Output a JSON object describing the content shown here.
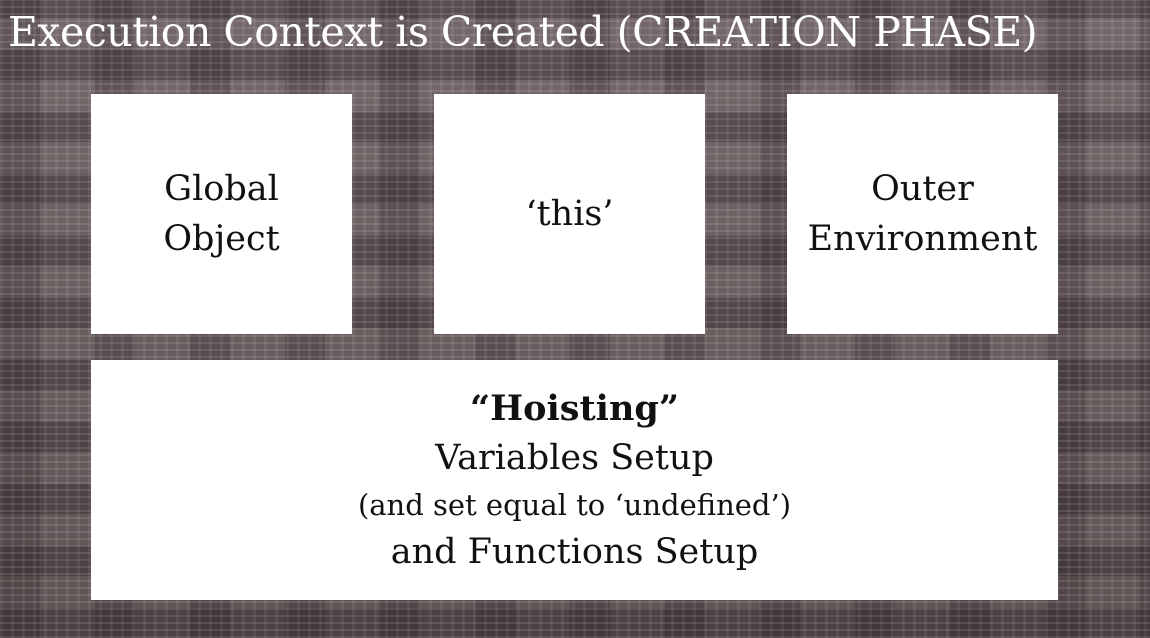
{
  "title": "Execution Context is Created (CREATION PHASE)",
  "boxes": {
    "global_object": {
      "lines": [
        "Global",
        "Object"
      ]
    },
    "this": {
      "lines": [
        "‘this’"
      ]
    },
    "outer_environment": {
      "lines": [
        "Outer",
        "Environment"
      ]
    },
    "hoisting": {
      "heading": "“Hoisting”",
      "line1": "Variables Setup",
      "note": "(and set equal to ‘undefined’)",
      "line2": "and Functions Setup"
    }
  },
  "colors": {
    "background": "#6b5f60",
    "box_fill": "#ffffff",
    "title_text": "#ffffff",
    "box_text": "#111111"
  }
}
